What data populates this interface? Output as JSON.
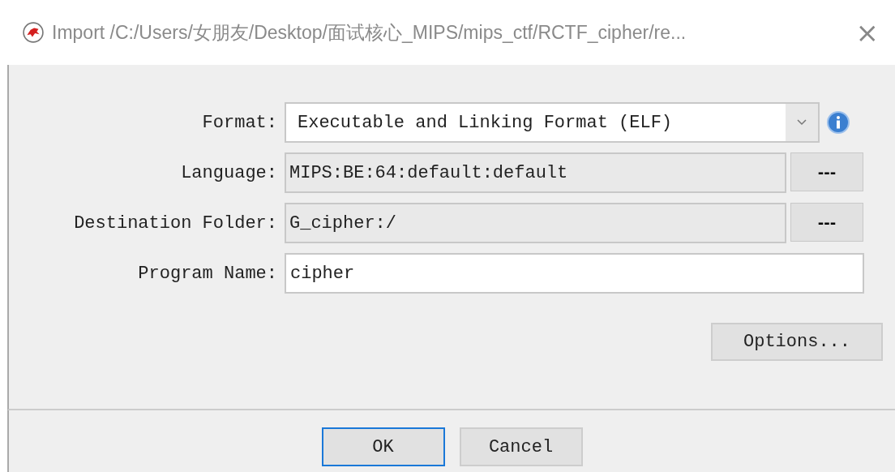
{
  "window": {
    "title": "Import /C:/Users/女朋友/Desktop/面试核心_MIPS/mips_ctf/RCTF_cipher/re...",
    "close": "×"
  },
  "fields": [
    {
      "kind": "select",
      "label": "Format:",
      "value": "Executable and Linking Format (ELF)"
    },
    {
      "kind": "browse",
      "label": "Language:",
      "value": "MIPS:BE:64:default:default",
      "button": "---"
    },
    {
      "kind": "browse",
      "label": "Destination Folder:",
      "value": "G_cipher:/",
      "button": "---"
    },
    {
      "kind": "text",
      "label": "Program Name:",
      "value": "cipher"
    }
  ],
  "options_button": "Options...",
  "buttons": [
    {
      "label": "OK",
      "selected": true
    },
    {
      "label": "Cancel",
      "selected": false
    }
  ]
}
